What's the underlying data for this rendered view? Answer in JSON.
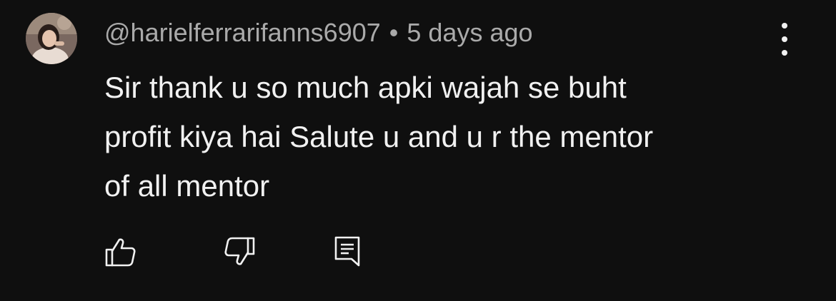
{
  "comment": {
    "author": "@harielferrarifanns6907",
    "separator": "•",
    "timestamp": "5 days ago",
    "text_lines": [
      "Sir thank u so much apki wajah se buht",
      "profit kiya hai Salute u and u r the mentor",
      "of all mentor"
    ]
  },
  "icons": {
    "menu": "more-vertical-icon",
    "like": "thumb-up-icon",
    "dislike": "thumb-down-icon",
    "reply": "reply-comment-icon"
  },
  "colors": {
    "background": "#0f0f0f",
    "text_primary": "#f1f1f1",
    "text_secondary": "#aaaaaa"
  }
}
